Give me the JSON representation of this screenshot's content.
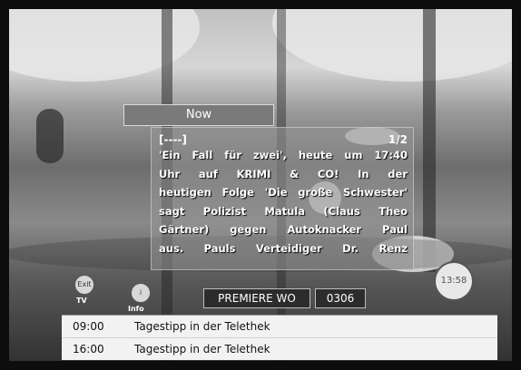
{
  "header": {
    "title": "Now"
  },
  "info": {
    "marker": "[----]",
    "page": "1/2",
    "lines": [
      "'Ein Fall für zwei', heute um 17:40",
      "Uhr auf KRIMI & CO! In der",
      "heutigen Folge 'Die große Schwester'",
      "sagt Polizist Matula (Claus Theo",
      "Gärtner) gegen Autoknacker Paul",
      "aus. Pauls Verteidiger Dr. Renz"
    ]
  },
  "clock": "13:58",
  "buttons": {
    "exit": {
      "icon": "Exit",
      "caption": "TV"
    },
    "info": {
      "icon": "i",
      "caption": "Info"
    }
  },
  "channel": {
    "name": "PREMIERE WO",
    "number": "0306"
  },
  "schedule": [
    {
      "time": "09:00",
      "title": "Tagestipp in der Telethek"
    },
    {
      "time": "16:00",
      "title": "Tagestipp in der Telethek"
    }
  ]
}
